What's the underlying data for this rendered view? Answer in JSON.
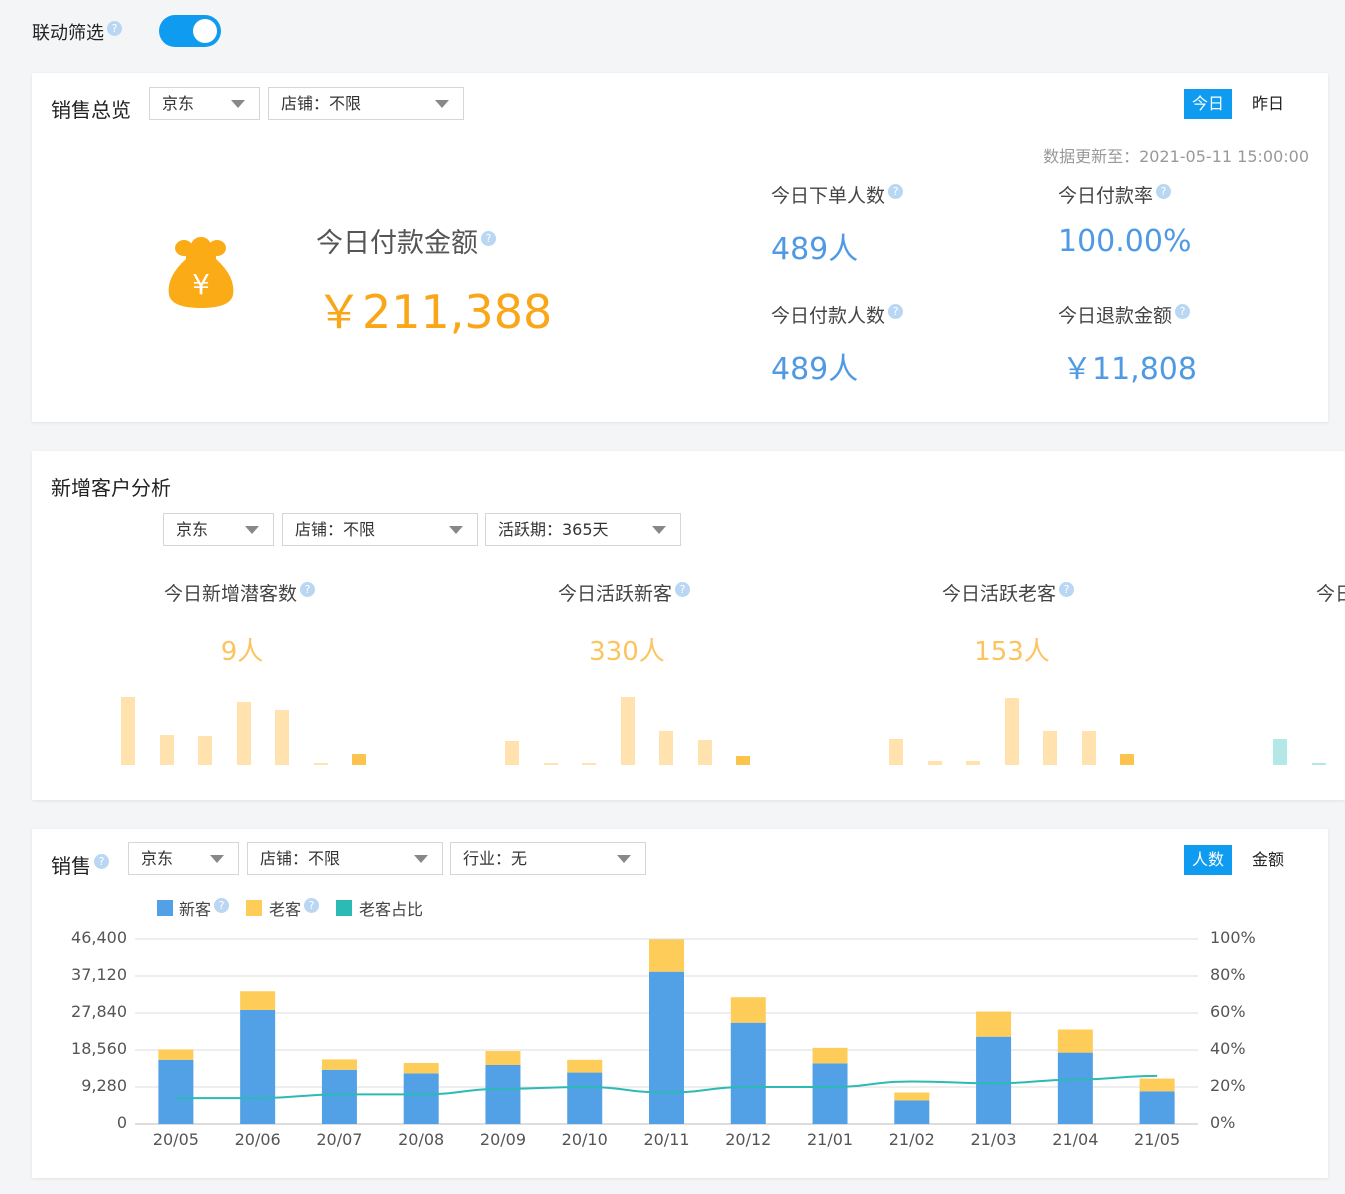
{
  "top": {
    "linked_filter_label": "联动筛选",
    "toggle_on": true
  },
  "sales_overview": {
    "title": "销售总览",
    "platform": "京东",
    "store": "店铺：不限",
    "tabs": [
      "今日",
      "昨日"
    ],
    "active_tab": 0,
    "updated": "数据更新至：2021-05-11 15:00:00",
    "main_label": "今日付款金额",
    "main_value": "￥211,388",
    "moneybag_symbol": "¥",
    "kpis": [
      {
        "label": "今日下单人数",
        "value": "489人"
      },
      {
        "label": "今日付款率",
        "value": "100.00%"
      },
      {
        "label": "今日付款人数",
        "value": "489人"
      },
      {
        "label": "今日退款金额",
        "value": "￥11,808"
      }
    ]
  },
  "new_customers": {
    "title": "新增客户分析",
    "platform": "京东",
    "store": "店铺：不限",
    "active_period": "活跃期：365天",
    "metrics": [
      {
        "label": "今日新增潜客数",
        "value": "9人",
        "spark": [
          68,
          30,
          29,
          63,
          55,
          2,
          11
        ]
      },
      {
        "label": "今日活跃新客",
        "value": "330人",
        "spark": [
          24,
          2,
          2,
          68,
          34,
          25,
          9
        ]
      },
      {
        "label": "今日活跃老客",
        "value": "153人",
        "spark": [
          26,
          4,
          4,
          67,
          34,
          34,
          11
        ]
      },
      {
        "label": "今日",
        "value": "",
        "spark": [
          26,
          2
        ]
      }
    ]
  },
  "sales": {
    "title": "销售",
    "platform": "京东",
    "store": "店铺：不限",
    "industry": "行业：无",
    "tabs": [
      "人数",
      "金额"
    ],
    "active_tab": 0,
    "legend": [
      "新客",
      "老客",
      "老客占比"
    ],
    "colors": {
      "new": "#52a0e6",
      "old": "#fecc58",
      "ratio": "#2cbab5"
    }
  },
  "chart_data": {
    "type": "bar",
    "stacked": true,
    "categories": [
      "20/05",
      "20/06",
      "20/07",
      "20/08",
      "20/09",
      "20/10",
      "20/11",
      "20/12",
      "21/01",
      "21/02",
      "21/03",
      "21/04",
      "21/05"
    ],
    "series": [
      {
        "name": "新客",
        "values": [
          16100,
          28600,
          13600,
          12700,
          14800,
          12900,
          38200,
          25400,
          15200,
          5900,
          21900,
          17900,
          8200
        ]
      },
      {
        "name": "老客",
        "values": [
          2600,
          4700,
          2600,
          2600,
          3500,
          3200,
          8100,
          6400,
          3900,
          2000,
          6300,
          5800,
          3200
        ]
      },
      {
        "name": "老客占比",
        "axis": "right",
        "values": [
          14,
          14,
          16,
          16,
          19,
          20,
          17,
          20,
          20,
          23,
          22,
          24,
          26
        ]
      }
    ],
    "y_left": {
      "ticks": [
        "0",
        "9,280",
        "18,560",
        "27,840",
        "37,120",
        "46,400"
      ],
      "min": 0,
      "max": 46400
    },
    "y_right": {
      "ticks": [
        "0%",
        "20%",
        "40%",
        "60%",
        "80%",
        "100%"
      ],
      "min": 0,
      "max": 100
    },
    "grid": true,
    "legend_position": "top-left"
  }
}
